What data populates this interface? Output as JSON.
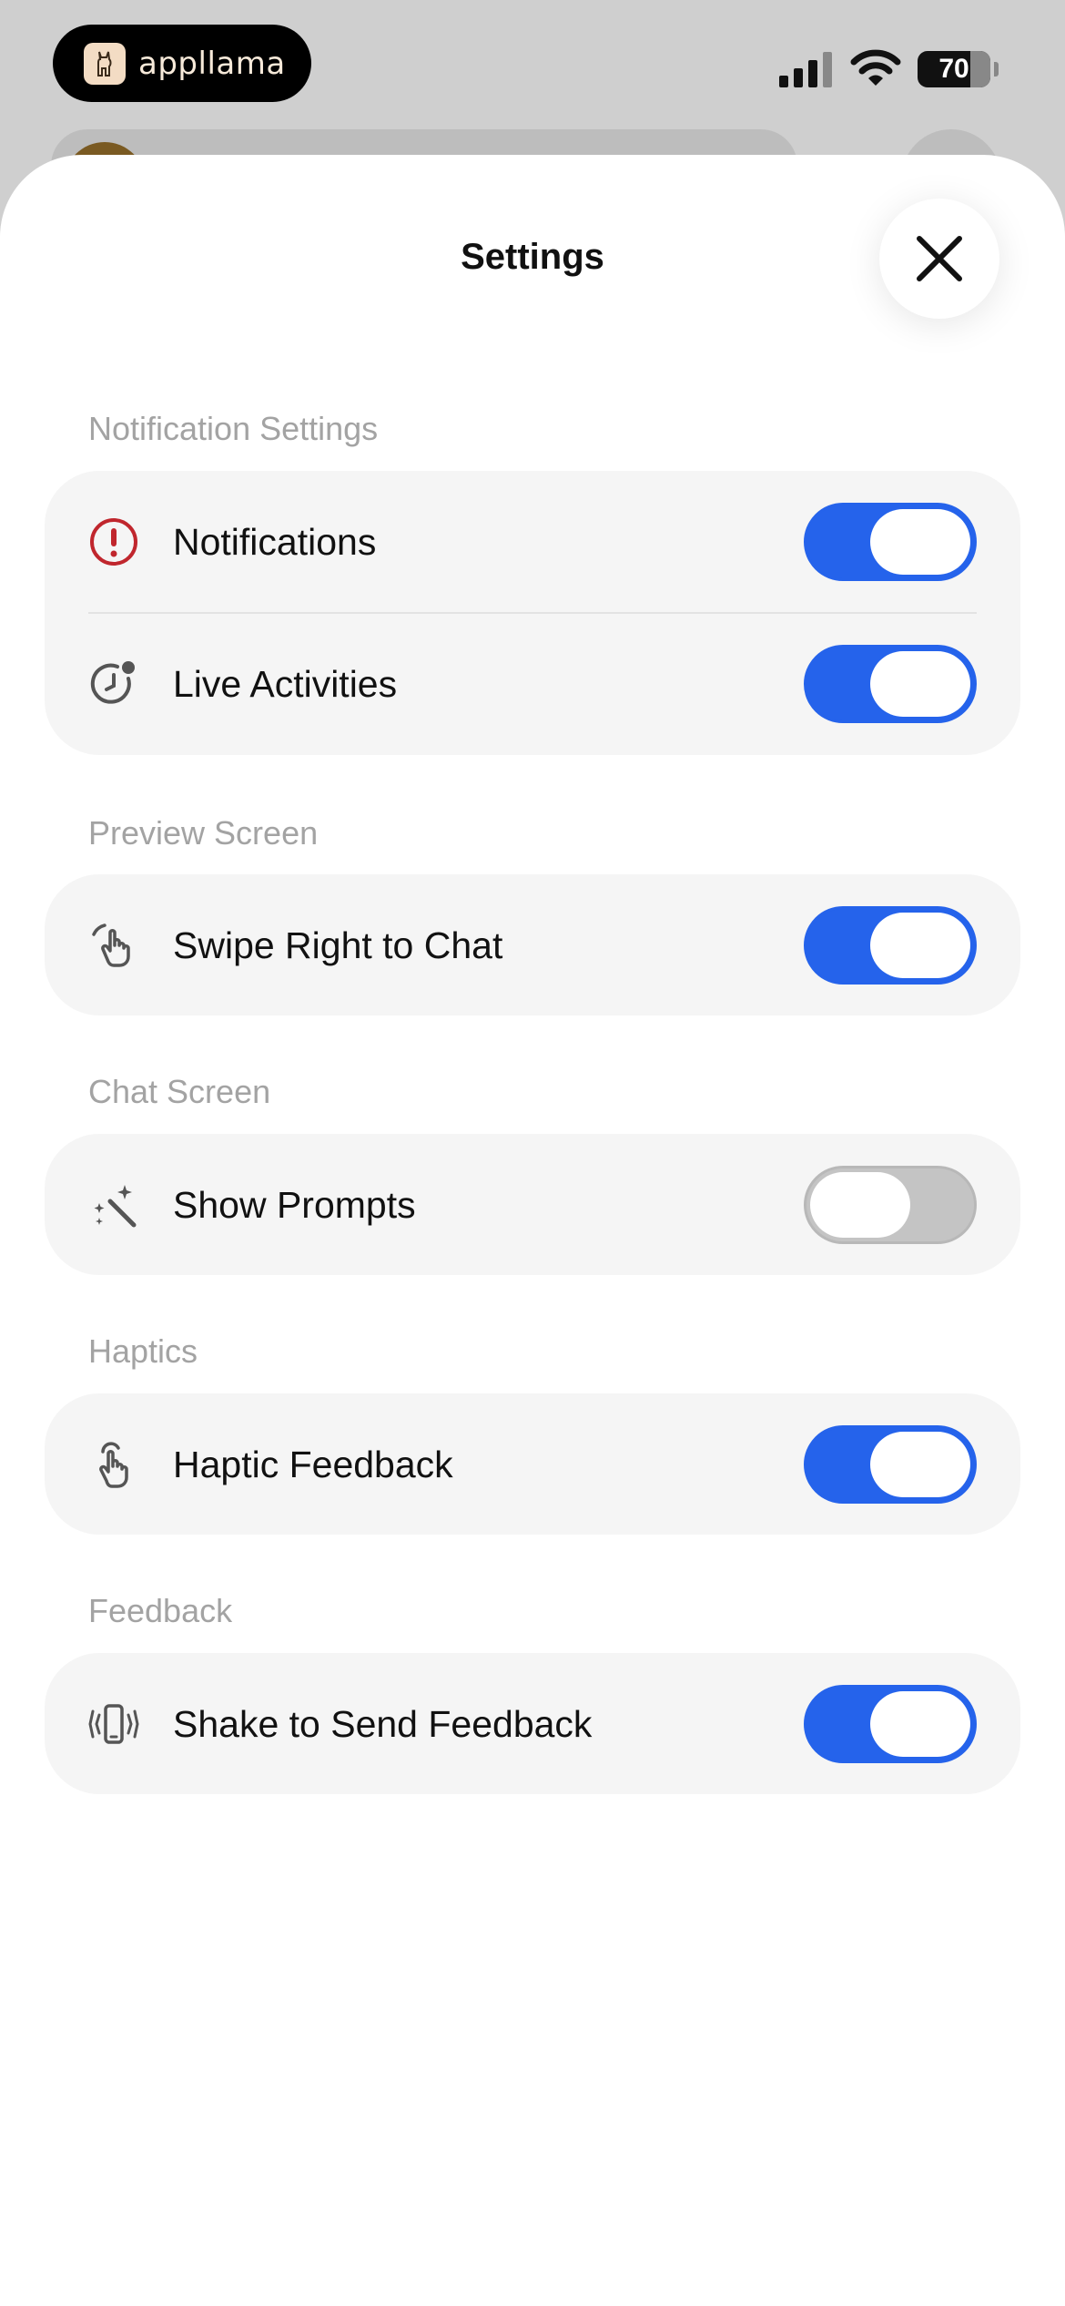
{
  "status_bar": {
    "app_name": "appllama",
    "battery": "70"
  },
  "sheet": {
    "title": "Settings"
  },
  "sections": [
    {
      "header": "Notification Settings",
      "rows": [
        {
          "label": "Notifications",
          "icon": "alert-circle-icon",
          "on": true
        },
        {
          "label": "Live Activities",
          "icon": "live-activity-icon",
          "on": true
        }
      ]
    },
    {
      "header": "Preview Screen",
      "rows": [
        {
          "label": "Swipe Right to Chat",
          "icon": "swipe-hand-icon",
          "on": true
        }
      ]
    },
    {
      "header": "Chat Screen",
      "rows": [
        {
          "label": "Show Prompts",
          "icon": "magic-wand-icon",
          "on": false
        }
      ]
    },
    {
      "header": "Haptics",
      "rows": [
        {
          "label": "Haptic Feedback",
          "icon": "tap-hand-icon",
          "on": true
        }
      ]
    },
    {
      "header": "Feedback",
      "rows": [
        {
          "label": "Shake to Send Feedback",
          "icon": "phone-shake-icon",
          "on": true
        }
      ]
    }
  ],
  "colors": {
    "toggle_on": "#2563eb",
    "toggle_off": "#c4c4c4",
    "alert_red": "#c0262d",
    "section_header": "#a3a3a3"
  }
}
